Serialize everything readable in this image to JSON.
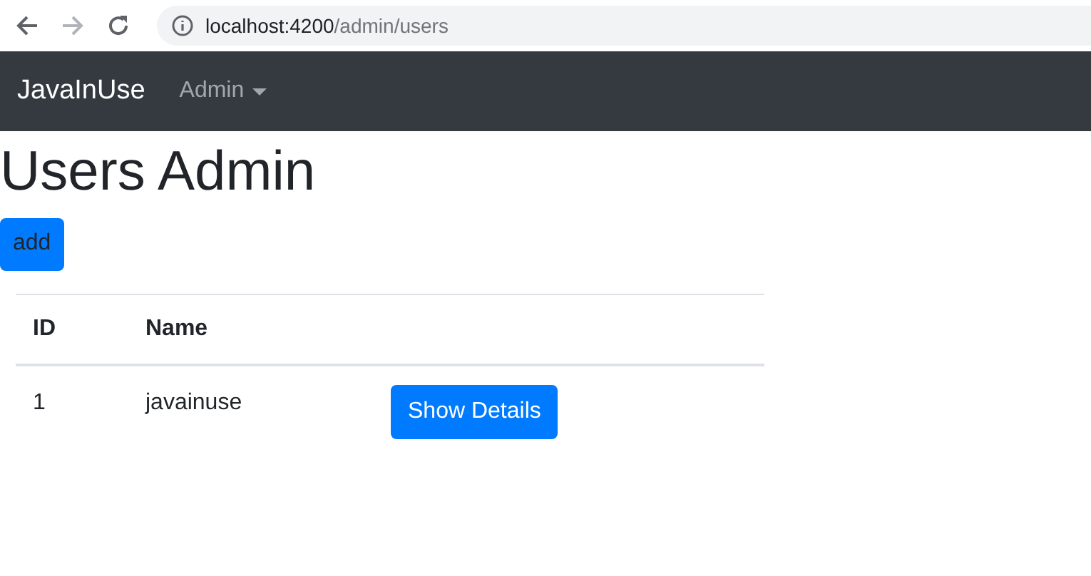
{
  "browser": {
    "back_disabled": false,
    "forward_disabled": true,
    "url_host": "localhost:4200",
    "url_path": "/admin/users"
  },
  "navbar": {
    "brand": "JavaInUse",
    "menu": "Admin"
  },
  "heading": "Users Admin",
  "add_button": "add",
  "table": {
    "columns": [
      "ID",
      "Name"
    ],
    "rows": [
      {
        "cells": [
          "1",
          "javainuse"
        ],
        "action": "Show Details"
      }
    ]
  }
}
